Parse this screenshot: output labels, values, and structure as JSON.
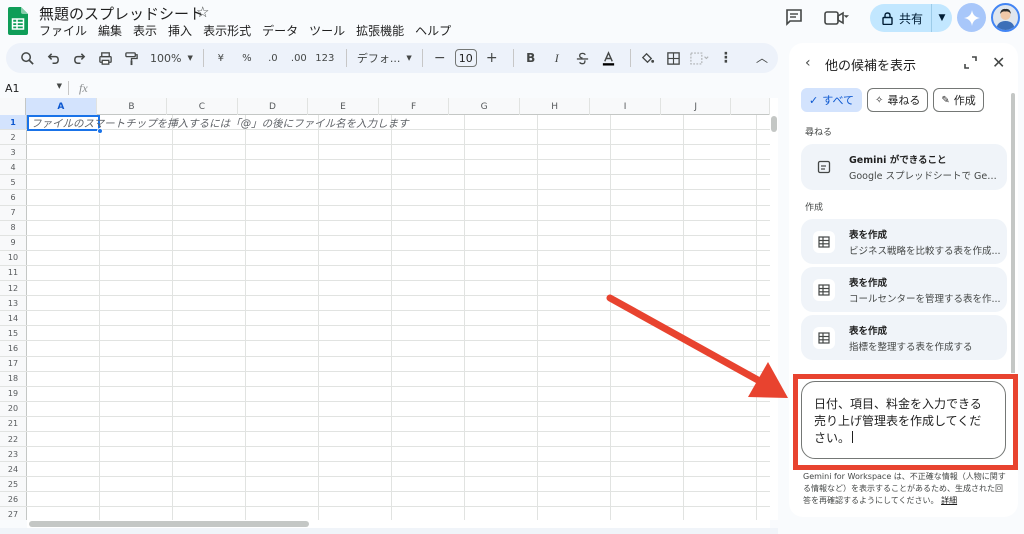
{
  "app": {
    "title": "無題のスプレッドシート",
    "menu": [
      "ファイル",
      "編集",
      "表示",
      "挿入",
      "表示形式",
      "データ",
      "ツール",
      "拡張機能",
      "ヘルプ"
    ],
    "share_label": "共有"
  },
  "toolbar": {
    "zoom": "100%",
    "currency": "¥",
    "percent": "%",
    "dec_decrease": ".0",
    "dec_increase": ".00",
    "number_format": "123",
    "font": "デフォ...",
    "font_size": "10",
    "bold": "B",
    "italic": "I"
  },
  "formula_bar": {
    "cell_ref": "A1",
    "fx": "fx"
  },
  "sheet": {
    "columns": [
      "A",
      "B",
      "C",
      "D",
      "E",
      "F",
      "G",
      "H",
      "I",
      "J"
    ],
    "rows": [
      "1",
      "2",
      "3",
      "4",
      "5",
      "6",
      "7",
      "8",
      "9",
      "10",
      "11",
      "12",
      "13",
      "14",
      "15",
      "16",
      "17",
      "18",
      "19",
      "20",
      "21",
      "22",
      "23",
      "24",
      "25",
      "26",
      "27"
    ],
    "hint": "ファイルのスマートチップを挿入するには「@」の後にファイル名を入力します"
  },
  "panel": {
    "title": "他の候補を表示",
    "chips": [
      {
        "label": "すべて",
        "active": true
      },
      {
        "label": "尋ねる",
        "active": false
      },
      {
        "label": "作成",
        "active": false
      }
    ],
    "ask_section": "尋ねる",
    "ask_cards": [
      {
        "title": "Gemini ができること",
        "subtitle": "Google スプレッドシートで Gemi..."
      }
    ],
    "create_section": "作成",
    "create_cards": [
      {
        "title": "表を作成",
        "subtitle": "ビジネス戦略を比較する表を作成..."
      },
      {
        "title": "表を作成",
        "subtitle": "コールセンターを管理する表を作..."
      },
      {
        "title": "表を作成",
        "subtitle": "指標を整理する表を作成する"
      }
    ],
    "prompt_text": "日付、項目、料金を入力できる売り上げ管理表を作成してください。",
    "disclaimer": "Gemini for Workspace は、不正確な情報（人物に関する情報など）を表示することがあるため、生成された回答を再確認するようにしてください。",
    "disclaimer_link": "詳細"
  },
  "colors": {
    "accent": "#0b57d0",
    "share_bg": "#c2e7ff",
    "annotation": "#e8432f"
  }
}
